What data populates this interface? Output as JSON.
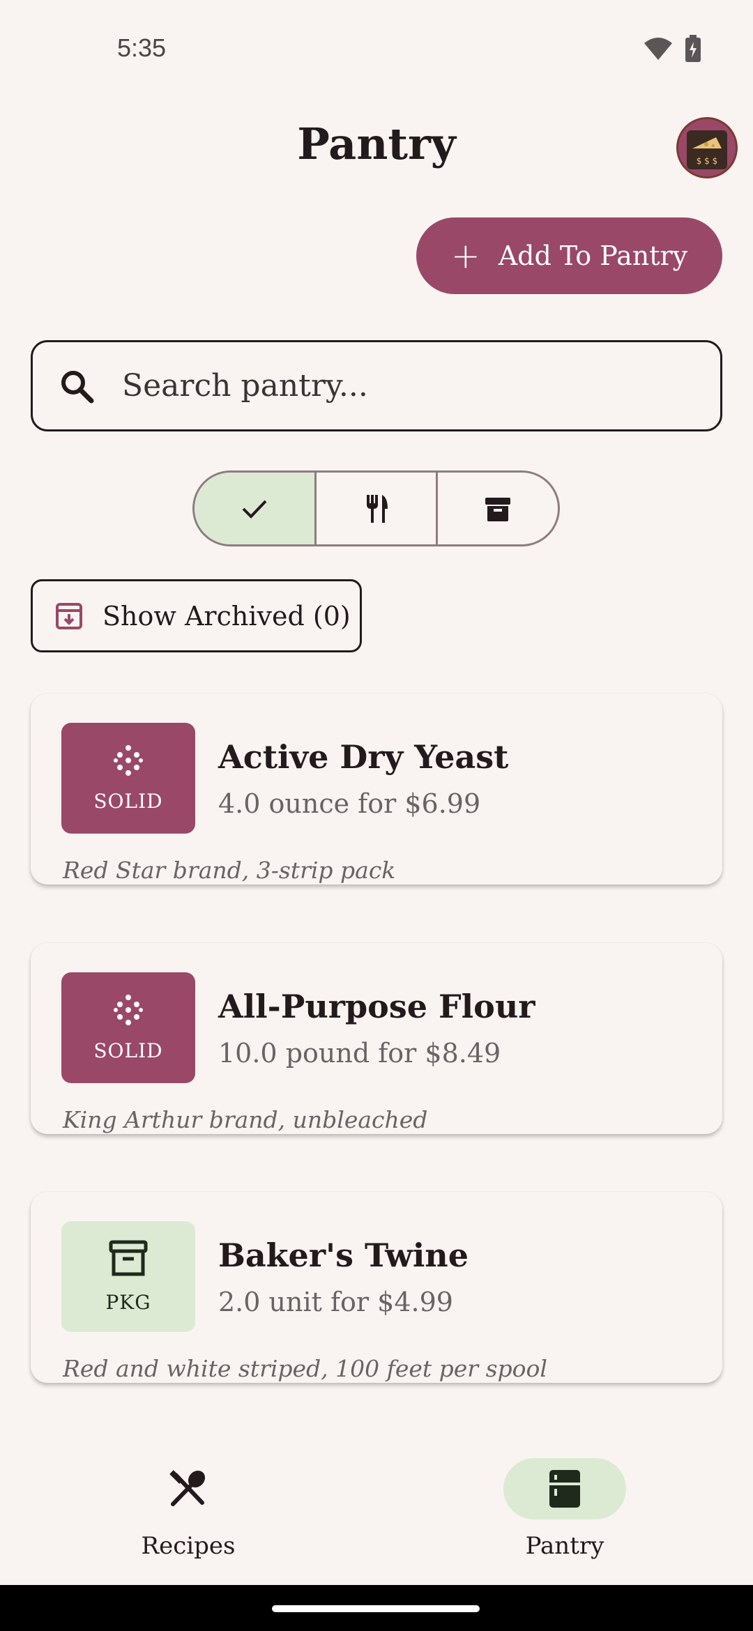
{
  "status_bar": {
    "time": "5:35"
  },
  "header": {
    "title": "Pantry"
  },
  "actions": {
    "add_label": "Add To Pantry"
  },
  "search": {
    "placeholder": "Search pantry..."
  },
  "filters": {
    "segments": [
      {
        "icon": "check-icon",
        "active": true
      },
      {
        "icon": "fork-knife-icon",
        "active": false
      },
      {
        "icon": "archive-box-icon",
        "active": false
      }
    ],
    "show_archived_label": "Show Archived (0)"
  },
  "items": [
    {
      "badge": "SOLID",
      "badge_icon": "dots-grid-icon",
      "name": "Active Dry Yeast",
      "price": "4.0 ounce for $6.99",
      "note": "Red Star brand, 3-strip pack"
    },
    {
      "badge": "SOLID",
      "badge_icon": "dots-grid-icon",
      "name": "All-Purpose Flour",
      "price": "10.0 pound for $8.49",
      "note": "King Arthur brand, unbleached"
    },
    {
      "badge": "PKG",
      "badge_icon": "package-box-icon",
      "name": "Baker's Twine",
      "price": "2.0 unit for $4.99",
      "note": "Red and white striped, 100 feet per spool"
    }
  ],
  "nav": {
    "items": [
      {
        "label": "Recipes",
        "icon": "fork-spoon-icon",
        "active": false
      },
      {
        "label": "Pantry",
        "icon": "fridge-icon",
        "active": true
      }
    ]
  },
  "colors": {
    "background": "#f9f4f1",
    "primary": "#9a4868",
    "secondary_container": "#dcead4",
    "text": "#231a1d",
    "muted_text": "#6a6264"
  }
}
